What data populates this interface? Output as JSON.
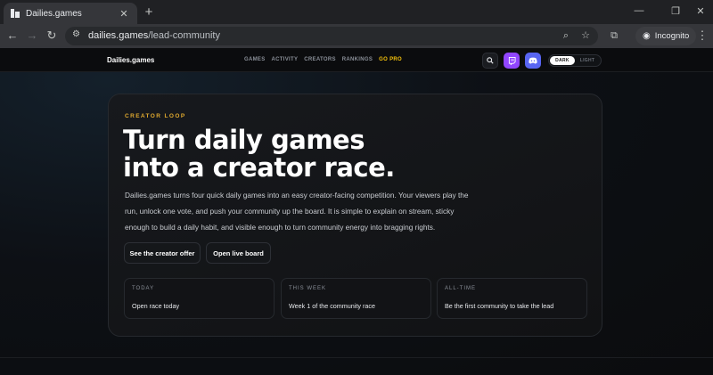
{
  "browser": {
    "tab_title": "Dailies.games",
    "url_host": "dailies.games",
    "url_path": "/lead-community",
    "incognito_label": "Incognito"
  },
  "site": {
    "logo": "Dailies.games",
    "nav": [
      "GAMES",
      "ACTIVITY",
      "CREATORS",
      "RANKINGS",
      "GO PRO"
    ],
    "theme_dark": "DARK",
    "theme_light": "LIGHT",
    "accent_color": "#f5c20b",
    "twitch_color": "#9146ff",
    "discord_color": "#5865f2"
  },
  "hero": {
    "eyebrow": "CREATOR LOOP",
    "headline_line1": "Turn daily games",
    "headline_line2": "into a creator race.",
    "description": "Dailies.games turns four quick daily games into an easy creator-facing competition. Your viewers play the run, unlock one vote, and push your community up the board. It is simple to explain on stream, sticky enough to build a daily habit, and visible enough to turn community energy into bragging rights.",
    "cta_primary": "See the creator offer",
    "cta_secondary": "Open live board"
  },
  "stats": [
    {
      "label": "TODAY",
      "value": "Open race today"
    },
    {
      "label": "THIS WEEK",
      "value": "Week 1 of the community race"
    },
    {
      "label": "ALL-TIME",
      "value": "Be the first community to take the lead"
    }
  ]
}
